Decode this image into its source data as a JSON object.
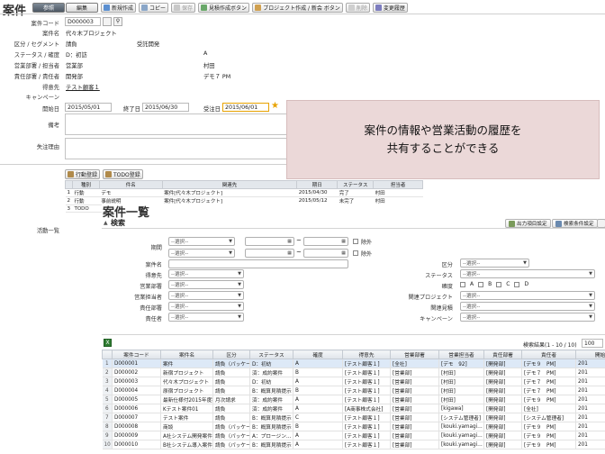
{
  "detail": {
    "title": "案件",
    "tabs": [
      "参照",
      "編集"
    ],
    "toolbar": [
      "新規作成",
      "コピー",
      "保存",
      "見積作成ボタン",
      "プロジェクト作成 / 新会 ボタン",
      "削除",
      "変更履歴"
    ],
    "fields": {
      "code_label": "案件コード",
      "code_value": "D000003",
      "name_label": "案件名",
      "name_value": "代々木プロジェクト",
      "segment_label": "区分 / セグメント",
      "segment_value1": "請負",
      "segment_value2": "受託開発",
      "status_label": "ステータス / 確度",
      "status_value": "D：初訪",
      "status_rank": "A",
      "dept_label": "営業部署 / 担当者",
      "dept_value": "営業部",
      "dept_person": "村田",
      "resp_label": "責任部署 / 責任者",
      "resp_value": "開発部",
      "resp_person": "デモ７ PM",
      "client_label": "得意先",
      "client_value": "テスト顧客１",
      "keyperson_label": "キャンペーン",
      "start_label": "開始日",
      "start_value": "2015/05/01",
      "end_label": "終了日",
      "end_value": "2015/06/30",
      "order_label": "受注日",
      "order_value": "2015/06/01",
      "remarks_label": "備考",
      "lost_label": "失注理由",
      "activity_label": "活動一覧"
    },
    "activity_buttons": [
      "行動登録",
      "TODO登録"
    ],
    "activity_headers": [
      "種別",
      "件名",
      "関連先",
      "期日",
      "ステータス",
      "担当者"
    ],
    "activity_rows": [
      {
        "no": "1",
        "type": "行動",
        "subject": "デモ",
        "related": "案件[代々木プロジェクト]",
        "date": "2015/04/30",
        "status": "完了",
        "person": "村田"
      },
      {
        "no": "2",
        "type": "行動",
        "subject": "事前説明",
        "related": "案件[代々木プロジェクト]",
        "date": "2015/05/12",
        "status": "未完了",
        "person": "村田"
      },
      {
        "no": "3",
        "type": "TODO",
        "subject": "",
        "related": "",
        "date": "",
        "status": "",
        "person": ""
      }
    ]
  },
  "callout": {
    "line1": "案件の情報や営業活動の履歴を",
    "line2": "共有することができる"
  },
  "list": {
    "title": "案件一覧",
    "search_title": "検索",
    "right_buttons": [
      "出力項目設定",
      "検索条件設定"
    ],
    "select_placeholder": "--選択--",
    "labels": {
      "period": "期間",
      "name": "案件名",
      "client": "得意先",
      "sales_dept": "営業部署",
      "sales_person": "営業担当者",
      "resp_dept": "責任部署",
      "resp_person": "責任者",
      "division": "区分",
      "status": "ステータス",
      "rank": "確度",
      "project": "関連プロジェクト",
      "quote": "関連見積",
      "campaign": "キャンペーン",
      "exclude": "除外"
    },
    "ranks": [
      "A",
      "B",
      "C",
      "D"
    ],
    "result_text": "検索結果(1 - 10 / 10)",
    "page_size": "100",
    "columns": [
      "案件コード",
      "案件名",
      "区分",
      "ステータス",
      "確度",
      "得意先",
      "営業部署",
      "営業担当者",
      "責任部署",
      "責任者",
      "開始"
    ],
    "rows": [
      [
        "D000001",
        "案件",
        "請負（パッケー…",
        "D：初訪",
        "A",
        "[テスト顧客１]",
        "[全社]",
        "[デモ　92]",
        "[開発部]",
        "[デモ９　PM]",
        "201"
      ],
      [
        "D000002",
        "新宿プロジェクト",
        "請負",
        "済：成約案件",
        "B",
        "[テスト顧客１]",
        "[営業部]",
        "[村田]",
        "[開発部]",
        "[デモ７　PM]",
        "201"
      ],
      [
        "D000003",
        "代々木プロジェクト",
        "請負",
        "D：初訪",
        "A",
        "[テスト顧客１]",
        "[営業部]",
        "[村田]",
        "[開発部]",
        "[デモ７　PM]",
        "201"
      ],
      [
        "D000004",
        "原宿プロジェクト",
        "請負",
        "B：概算見積提示",
        "B",
        "[テスト顧客１]",
        "[営業部]",
        "[村田]",
        "[開発部]",
        "[デモ７　PM]",
        "201"
      ],
      [
        "D000005",
        "最新仕様付2015年度案件",
        "月次請求",
        "済：成約案件",
        "A",
        "[テスト顧客１]",
        "[営業部]",
        "[村田]",
        "[開発部]",
        "[デモ９　PM]",
        "201"
      ],
      [
        "D000006",
        "Kテスト案件01",
        "請負",
        "済：成約案件",
        "A",
        "[A商事株式会社]",
        "[営業部]",
        "[kigawa]",
        "[開発部]",
        "[全社]",
        "201"
      ],
      [
        "D000007",
        "テスト案件",
        "請負",
        "B：概算見積提示",
        "C",
        "[テスト顧客１]",
        "[営業部]",
        "[システム管理者]",
        "[開発部]",
        "[システム管理者]",
        "201"
      ],
      [
        "D000008",
        "商談",
        "請負（パッケー…",
        "B：概算見積提示",
        "B",
        "[テスト顧客１]",
        "[営業部]",
        "[kouki.yamagi…",
        "[開発部]",
        "[デモ９　PM]",
        "201"
      ],
      [
        "D000009",
        "A社システム開発案件",
        "請負（パッケー…",
        "A：プロージン…",
        "A",
        "[テスト顧客１]",
        "[営業部]",
        "[kouki.yamagi…",
        "[開発部]",
        "[デモ９　PM]",
        "201"
      ],
      [
        "D000010",
        "B社システム導入案件",
        "請負（パッケー…",
        "B：概算見積提示",
        "A",
        "[テスト顧客１]",
        "[営業部]",
        "[kouki.yamagi…",
        "[開発部]",
        "[デモ９　PM]",
        "201"
      ]
    ]
  },
  "colors": {
    "callout_bg": "#ebd8d8",
    "selected_row": "#dde9f7",
    "header_bg": "#e3e7ec",
    "accent": "#e8a300"
  }
}
